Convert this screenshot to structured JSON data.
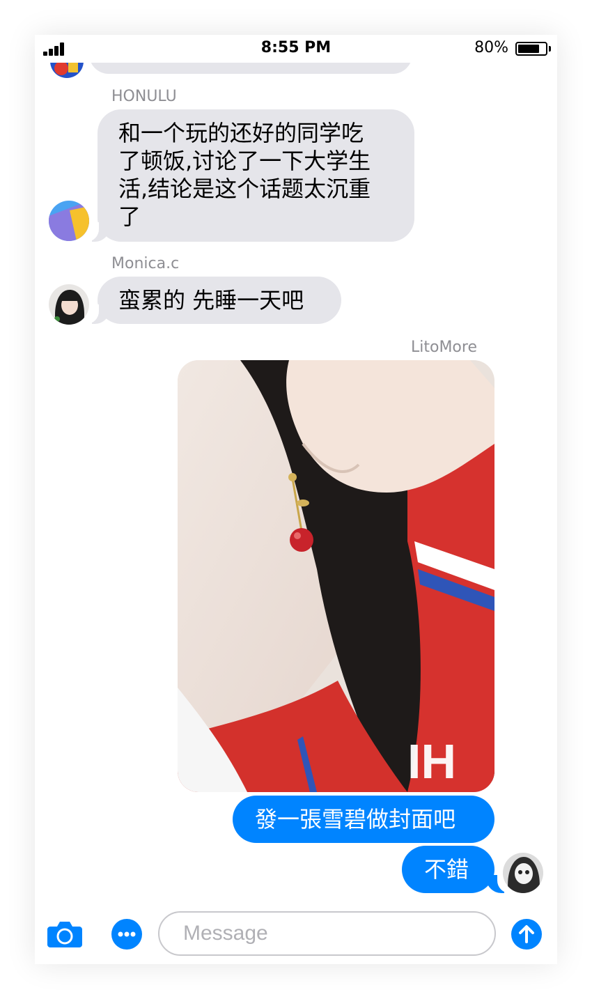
{
  "status_bar": {
    "time": "8:55 PM",
    "battery_percent": "80%",
    "battery_level": 0.8
  },
  "messages": [
    {
      "sender": "HONULU",
      "text": "和一个玩的还好的同学吃\n了顿饭,讨论了一下大学生\n活,结论是这个话题太沉重\n了"
    },
    {
      "sender": "Monica.c",
      "text": "蛮累的 先睡一天吧"
    },
    {
      "sender": "LitoMore",
      "image_alt": "earring photo"
    },
    {
      "text": "發一張雪碧做封面吧"
    },
    {
      "text": "不錯"
    }
  ],
  "input_bar": {
    "placeholder": "Message"
  },
  "colors": {
    "outgoing": "#0084ff",
    "incoming": "#e5e5ea",
    "sender_label": "#8e8e93"
  },
  "icons": [
    "camera-icon",
    "more-options-icon",
    "send-arrow-icon",
    "signal-icon",
    "battery-icon"
  ]
}
